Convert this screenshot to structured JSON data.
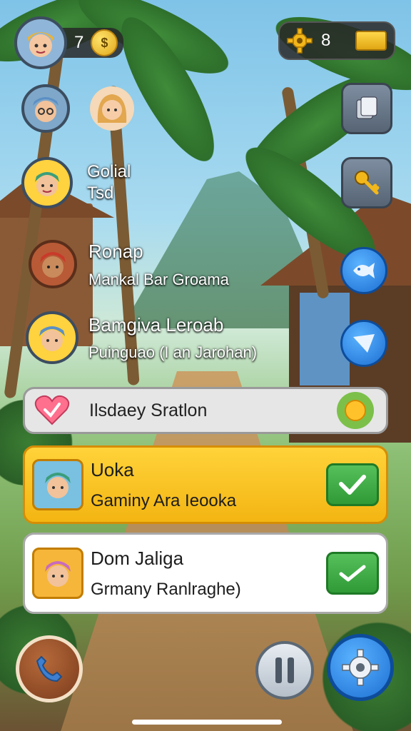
{
  "hud": {
    "left_count": "7",
    "right_count": "8"
  },
  "players": [
    {
      "name": "Golial",
      "sub": "Tsd"
    },
    {
      "name": "Ronap",
      "sub": "Mankal Bar Groama"
    },
    {
      "name": "Bamgiva Leroab",
      "sub": "Puinguao (I an Jarohan)"
    }
  ],
  "banners": {
    "gray": {
      "label": "Ilsdaey Sratlon"
    },
    "yellow": {
      "title": "Uoka",
      "sub": "Gaminy Ara Ieooka"
    },
    "white": {
      "title": "Dom Jaliga",
      "sub": "Grmany Ranlraghe)"
    }
  },
  "colors": {
    "accent_yellow": "#f3b512",
    "accent_green": "#2f9a36",
    "accent_blue": "#1d6fd3"
  },
  "icons": [
    "coin-icon",
    "gear-icon",
    "gold-bar-icon",
    "cards-icon",
    "key-icon",
    "fish-icon",
    "shield-icon",
    "heart-icon",
    "sun-icon",
    "check-icon",
    "phone-icon",
    "pause-icon",
    "settings-icon"
  ]
}
